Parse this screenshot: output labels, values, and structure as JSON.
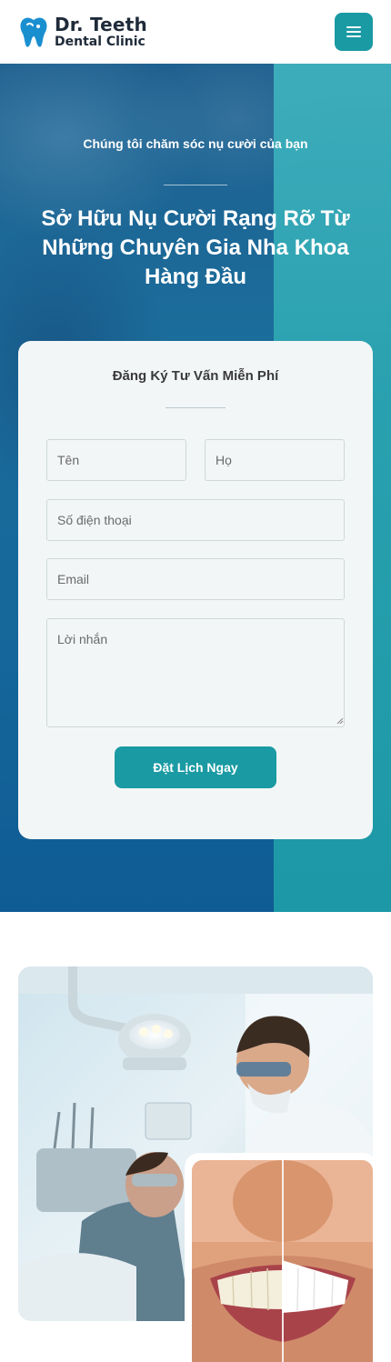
{
  "brand": {
    "name": "Dr. Teeth",
    "subtitle": "Dental Clinic",
    "accent_color": "#1a9aa3"
  },
  "header": {
    "menu_icon": "hamburger-menu-icon"
  },
  "hero": {
    "tagline": "Chúng tôi chăm sóc nụ cười của bạn",
    "title": "Sở Hữu Nụ Cười Rạng Rỡ Từ Những Chuyên Gia Nha Khoa Hàng Đầu"
  },
  "form": {
    "title": "Đăng Ký Tư Vấn Miễn Phí",
    "first_name_placeholder": "Tên",
    "last_name_placeholder": "Họ",
    "phone_placeholder": "Số điện thoại",
    "email_placeholder": "Email",
    "message_placeholder": "Lời nhắn",
    "submit_label": "Đặt Lịch Ngay"
  },
  "gallery": {
    "main_photo": "dentist-with-patient-photo",
    "secondary_photo": "teeth-whitening-before-after-photo"
  }
}
